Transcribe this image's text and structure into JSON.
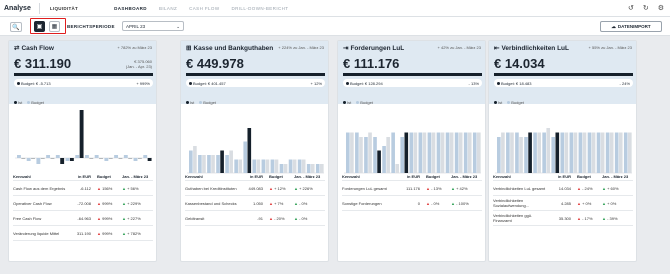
{
  "app": {
    "title": "Analyse",
    "section": "LIQUIDITÄT"
  },
  "nav": [
    "DASHBOARD",
    "BILANZ",
    "CASH FLOW",
    "DRILL-DOWN-BERICHT"
  ],
  "top_icons": [
    "history-icon",
    "refresh-icon",
    "settings-icon"
  ],
  "toolbar": {
    "period_label": "BERICHTSPERIODE",
    "period_value": "APRIL 23",
    "import_label": "DATENIMPORT"
  },
  "legend": {
    "ist": "Ist",
    "budget": "Budget"
  },
  "table_headers": {
    "kennzahl": "Kennzahl",
    "eur": "in EUR",
    "budget": "Budget",
    "prev": "Jan. - März 23"
  },
  "cards": [
    {
      "title": "Cash Flow",
      "cmp": "+ 782% zu März 23",
      "value": "€ 311.190",
      "cmp_val": "€ 375.060",
      "cmp_sub": "(Jan. - Apr. 23)",
      "budget": "Budget: € -5.713",
      "budget_pct": "+ 999%",
      "rows": [
        {
          "name": "Cash Flow aus dem Ergebnis",
          "eur": "-6.112",
          "budget": "156%",
          "prev": "+ 56%"
        },
        {
          "name": "Operativer Cash Flow",
          "eur": "-72.008",
          "budget": "999%",
          "prev": "+ 229%"
        },
        {
          "name": "Free Cash Flow",
          "eur": "-64.963",
          "budget": "999%",
          "prev": "+ 227%"
        },
        {
          "name": "Veränderung liquide Mittel",
          "eur": "311.190",
          "budget": "999%",
          "prev": "+ 782%"
        }
      ]
    },
    {
      "title": "Kasse und Bankguthaben",
      "cmp": "+ 224% zu Jan. - März 23",
      "value": "€ 449.978",
      "cmp_val": "",
      "cmp_sub": "",
      "budget": "Budget: € 401.457",
      "budget_pct": "+ 12%",
      "rows": [
        {
          "name": "Guthaben bei Kreditinstituten",
          "eur": "449.083",
          "budget": "+ 12%",
          "prev": "+ 226%"
        },
        {
          "name": "Kassenbestand und Schecks",
          "eur": "1.050",
          "budget": "+ 7%",
          "prev": "- 0%"
        },
        {
          "name": "Geldtransit",
          "eur": "-91",
          "budget": "- 20%",
          "prev": "- 0%"
        }
      ]
    },
    {
      "title": "Forderungen LuL",
      "cmp": "+ 42% zu Jan. - März 23",
      "value": "€ 111.176",
      "cmp_val": "",
      "cmp_sub": "",
      "budget": "Budget: € 128.294",
      "budget_pct": "- 13%",
      "rows": [
        {
          "name": "Forderungen LuL gesamt",
          "eur": "111.176",
          "budget": "- 13%",
          "prev": "+ 42%"
        },
        {
          "name": "Sonstige Forderungen",
          "eur": "0",
          "budget": "- 0%",
          "prev": "- 100%"
        }
      ]
    },
    {
      "title": "Verbindlichkeiten LuL",
      "cmp": "+ 55% zu Jan. - März 23",
      "value": "€ 14.034",
      "cmp_val": "",
      "cmp_sub": "",
      "budget": "Budget: € 18.483",
      "budget_pct": "- 24%",
      "rows": [
        {
          "name": "Verbindlichkeiten LuL gesamt",
          "eur": "14.034",
          "budget": "- 24%",
          "prev": "+ 60%"
        },
        {
          "name": "Verbindlichkeiten Sozialaufwendung...",
          "eur": "4.285",
          "budget": "+ 0%",
          "prev": "+ 0%"
        },
        {
          "name": "Verbindlichkeiten ggü. Finanzamt",
          "eur": "35.300",
          "budget": "- 17%",
          "prev": "- 39%"
        }
      ]
    }
  ],
  "colors": {
    "ist": "#15202b",
    "budget": "#b8cce0",
    "hist": "#d9dde2",
    "red": "#e01e1e"
  },
  "chart_data": [
    {
      "type": "bar",
      "series": [
        {
          "name": "Ist",
          "values": [
            0,
            0,
            0,
            0,
            -2,
            -1,
            16,
            0,
            0,
            0,
            0,
            0,
            0,
            -1
          ]
        },
        {
          "name": "Budget",
          "values": [
            1,
            -1,
            -2,
            1,
            1,
            -1,
            1,
            1,
            1,
            -1,
            1,
            1,
            -1,
            1
          ]
        }
      ]
    },
    {
      "type": "bar",
      "series": [
        {
          "name": "Ist",
          "values": [
            6,
            4,
            4,
            5,
            5,
            3,
            10,
            3,
            3,
            3,
            2,
            3,
            3,
            2,
            2
          ]
        },
        {
          "name": "Budget",
          "values": [
            5,
            4,
            4,
            4,
            4,
            3,
            7,
            3,
            3,
            3,
            2,
            3,
            3,
            2,
            2
          ]
        }
      ]
    },
    {
      "type": "bar",
      "series": [
        {
          "name": "Ist",
          "values": [
            9,
            8,
            9,
            5,
            8,
            2,
            9,
            9,
            9,
            9,
            9,
            9,
            9,
            9,
            9
          ]
        },
        {
          "name": "Budget",
          "values": [
            9,
            9,
            8,
            8,
            6,
            9,
            8,
            9,
            9,
            9,
            9,
            9,
            9,
            9,
            9
          ]
        }
      ]
    },
    {
      "type": "bar",
      "series": [
        {
          "name": "Ist",
          "values": [
            9,
            9,
            8,
            9,
            9,
            10,
            9,
            9,
            9,
            9,
            9,
            9,
            9,
            9,
            9
          ]
        },
        {
          "name": "Budget",
          "values": [
            8,
            9,
            9,
            8,
            9,
            9,
            8,
            9,
            9,
            9,
            9,
            9,
            9,
            9,
            9
          ]
        }
      ]
    }
  ]
}
